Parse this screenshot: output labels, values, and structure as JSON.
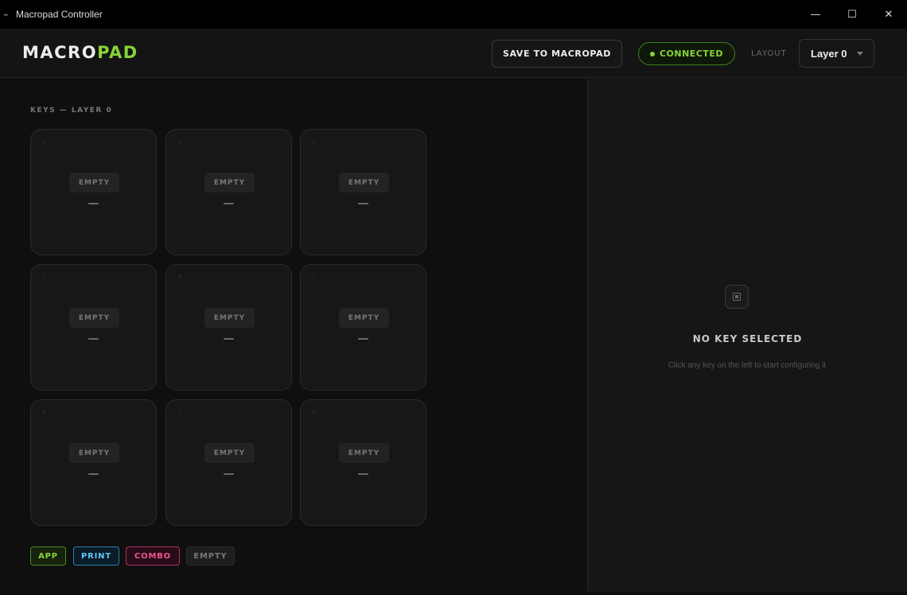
{
  "window": {
    "title": "Macropad Controller",
    "controls": {
      "minimize": "—",
      "maximize": "☐",
      "close": "✕"
    }
  },
  "header": {
    "logo_part1": "MACRO",
    "logo_part2": "PAD",
    "save_label": "SAVE TO MACROPAD",
    "status_label": "CONNECTED",
    "layout_label": "LAYOUT",
    "layer_value": "Layer 0"
  },
  "colors": {
    "accent_green": "#86d43a",
    "print_blue": "#5fc5f5",
    "combo_pink": "#f4558f",
    "background": "#0f0f0f"
  },
  "keys_section": {
    "title": "KEYS — LAYER 0",
    "keys": [
      {
        "index": "0",
        "tag": "EMPTY",
        "value": "—"
      },
      {
        "index": "1",
        "tag": "EMPTY",
        "value": "—"
      },
      {
        "index": "2",
        "tag": "EMPTY",
        "value": "—"
      },
      {
        "index": "3",
        "tag": "EMPTY",
        "value": "—"
      },
      {
        "index": "4",
        "tag": "EMPTY",
        "value": "—"
      },
      {
        "index": "5",
        "tag": "EMPTY",
        "value": "—"
      },
      {
        "index": "6",
        "tag": "EMPTY",
        "value": "—"
      },
      {
        "index": "7",
        "tag": "EMPTY",
        "value": "—"
      },
      {
        "index": "8",
        "tag": "EMPTY",
        "value": "—"
      }
    ]
  },
  "legend": {
    "app": "APP",
    "print": "PRINT",
    "combo": "COMBO",
    "empty": "EMPTY"
  },
  "detail_panel": {
    "icon": "key-placeholder-icon",
    "title": "NO KEY SELECTED",
    "description": "Click any key on the left to start configuring it"
  }
}
